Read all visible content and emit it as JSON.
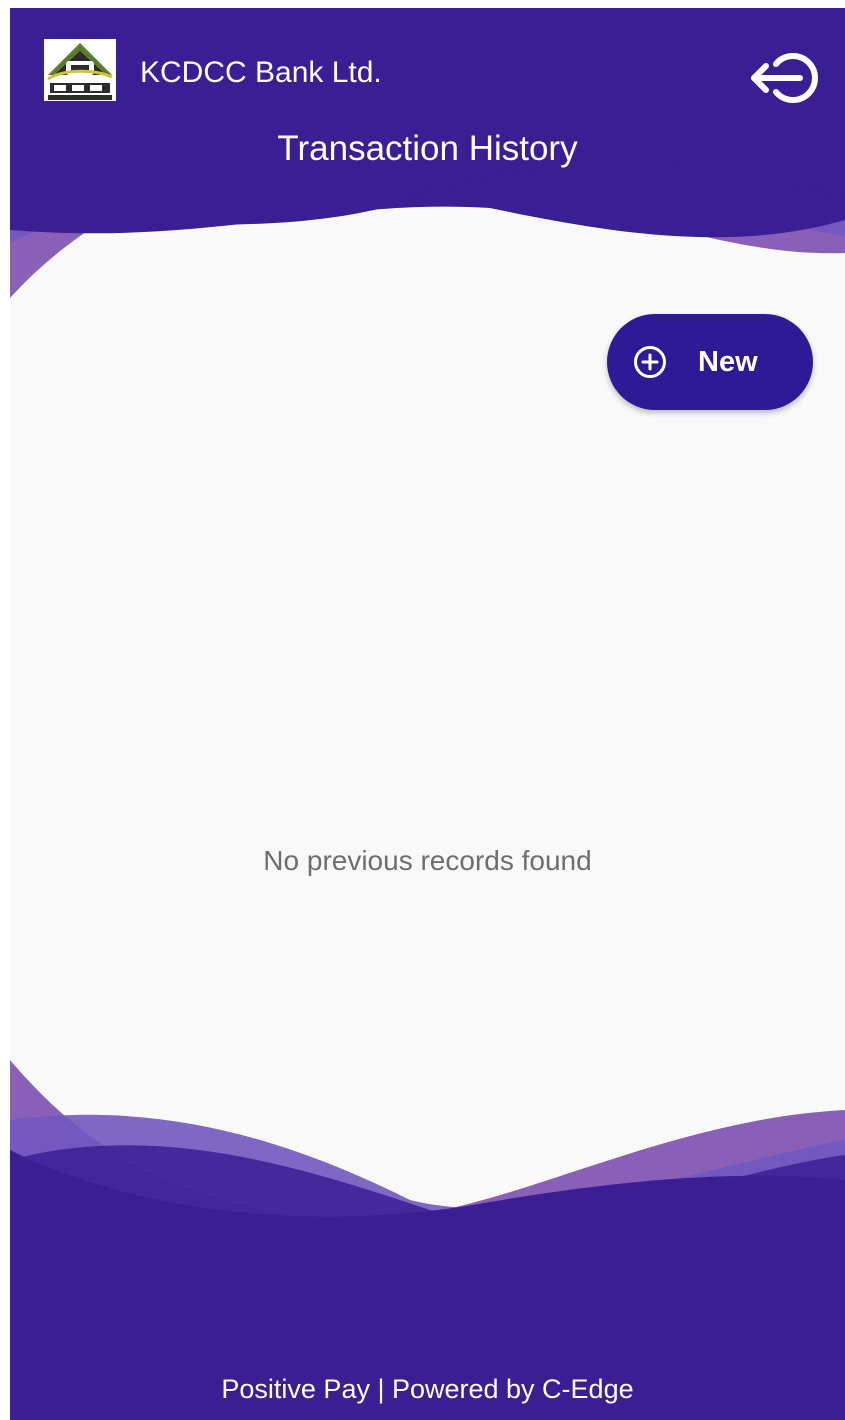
{
  "header": {
    "bank_name": "KCDCC Bank Ltd.",
    "logo_icon": "dcc-bank-logo-icon",
    "logout_icon": "logout-arrow-icon"
  },
  "page": {
    "title": "Transaction History"
  },
  "actions": {
    "new_label": "New",
    "new_icon": "plus-circle-icon"
  },
  "content": {
    "empty_message": "No previous records found"
  },
  "footer": {
    "text": "Positive Pay | Powered by C-Edge"
  },
  "colors": {
    "primary": "#3a1e94",
    "button": "#2e1a96",
    "wave_light": "#7e5cb6",
    "background": "#f9f9f9",
    "muted_text": "#6e6e6e"
  }
}
